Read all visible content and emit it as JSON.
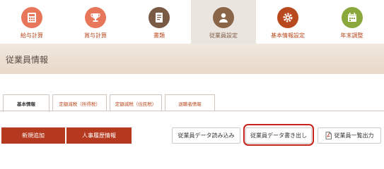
{
  "nav": {
    "items": [
      {
        "label": "給与計算",
        "icon": "payroll-calculator-icon",
        "color": "#e8765a"
      },
      {
        "label": "賞与計算",
        "icon": "bonus-trophy-icon",
        "color": "#e8765a"
      },
      {
        "label": "書類",
        "icon": "documents-icon",
        "color": "#7a5a45"
      },
      {
        "label": "従業員設定",
        "icon": "employee-person-icon",
        "color": "#8a6548"
      },
      {
        "label": "基本情報設定",
        "icon": "gear-icon",
        "color": "#b8491e"
      },
      {
        "label": "年末調整",
        "icon": "calendar-icon",
        "color": "#8aa83c"
      }
    ],
    "active_index": 3
  },
  "page": {
    "title": "従業員情報"
  },
  "tabs": [
    {
      "label": "基本情報"
    },
    {
      "label": "定額減税（所得税）"
    },
    {
      "label": "定額減税（住民税）"
    },
    {
      "label": "退職者情報"
    }
  ],
  "buttons": {
    "new_add": "新規追加",
    "personnel_history": "人事履歴情報",
    "import_data": "従業員データ読み込み",
    "export_data": "従業員データ書き出し",
    "list_output": "従業員一覧出力"
  }
}
